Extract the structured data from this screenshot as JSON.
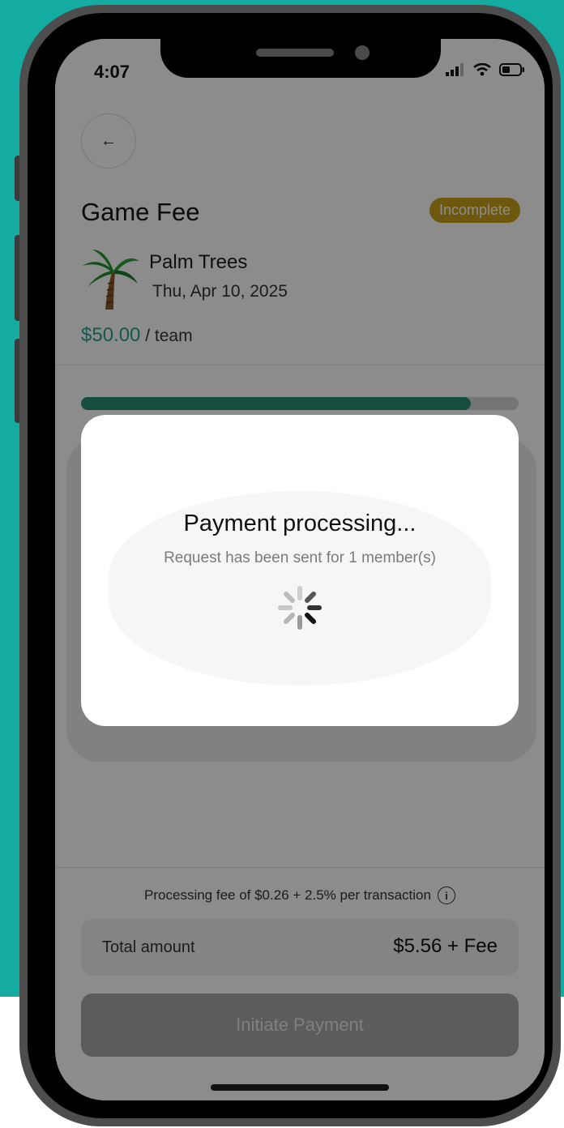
{
  "status_bar": {
    "time": "4:07"
  },
  "header": {
    "title": "Game Fee",
    "status_badge": "Incomplete"
  },
  "team": {
    "name": "Palm Trees",
    "date": "Thu, Apr 10, 2025"
  },
  "fee": {
    "amount": "$50.00",
    "unit": " / team"
  },
  "progress": {
    "fraction": 0.89
  },
  "footer": {
    "processing_fee_text": "Processing fee of $0.26 + 2.5% per transaction",
    "total_label": "Total amount",
    "total_value": "$5.56 + Fee",
    "initiate_label": "Initiate Payment"
  },
  "modal": {
    "title": "Payment processing...",
    "subtitle": "Request has been sent for 1 member(s)"
  },
  "colors": {
    "background": "#14aba1",
    "badge": "#c9a01a",
    "price": "#26a38e",
    "progress": "#2a8a76"
  }
}
